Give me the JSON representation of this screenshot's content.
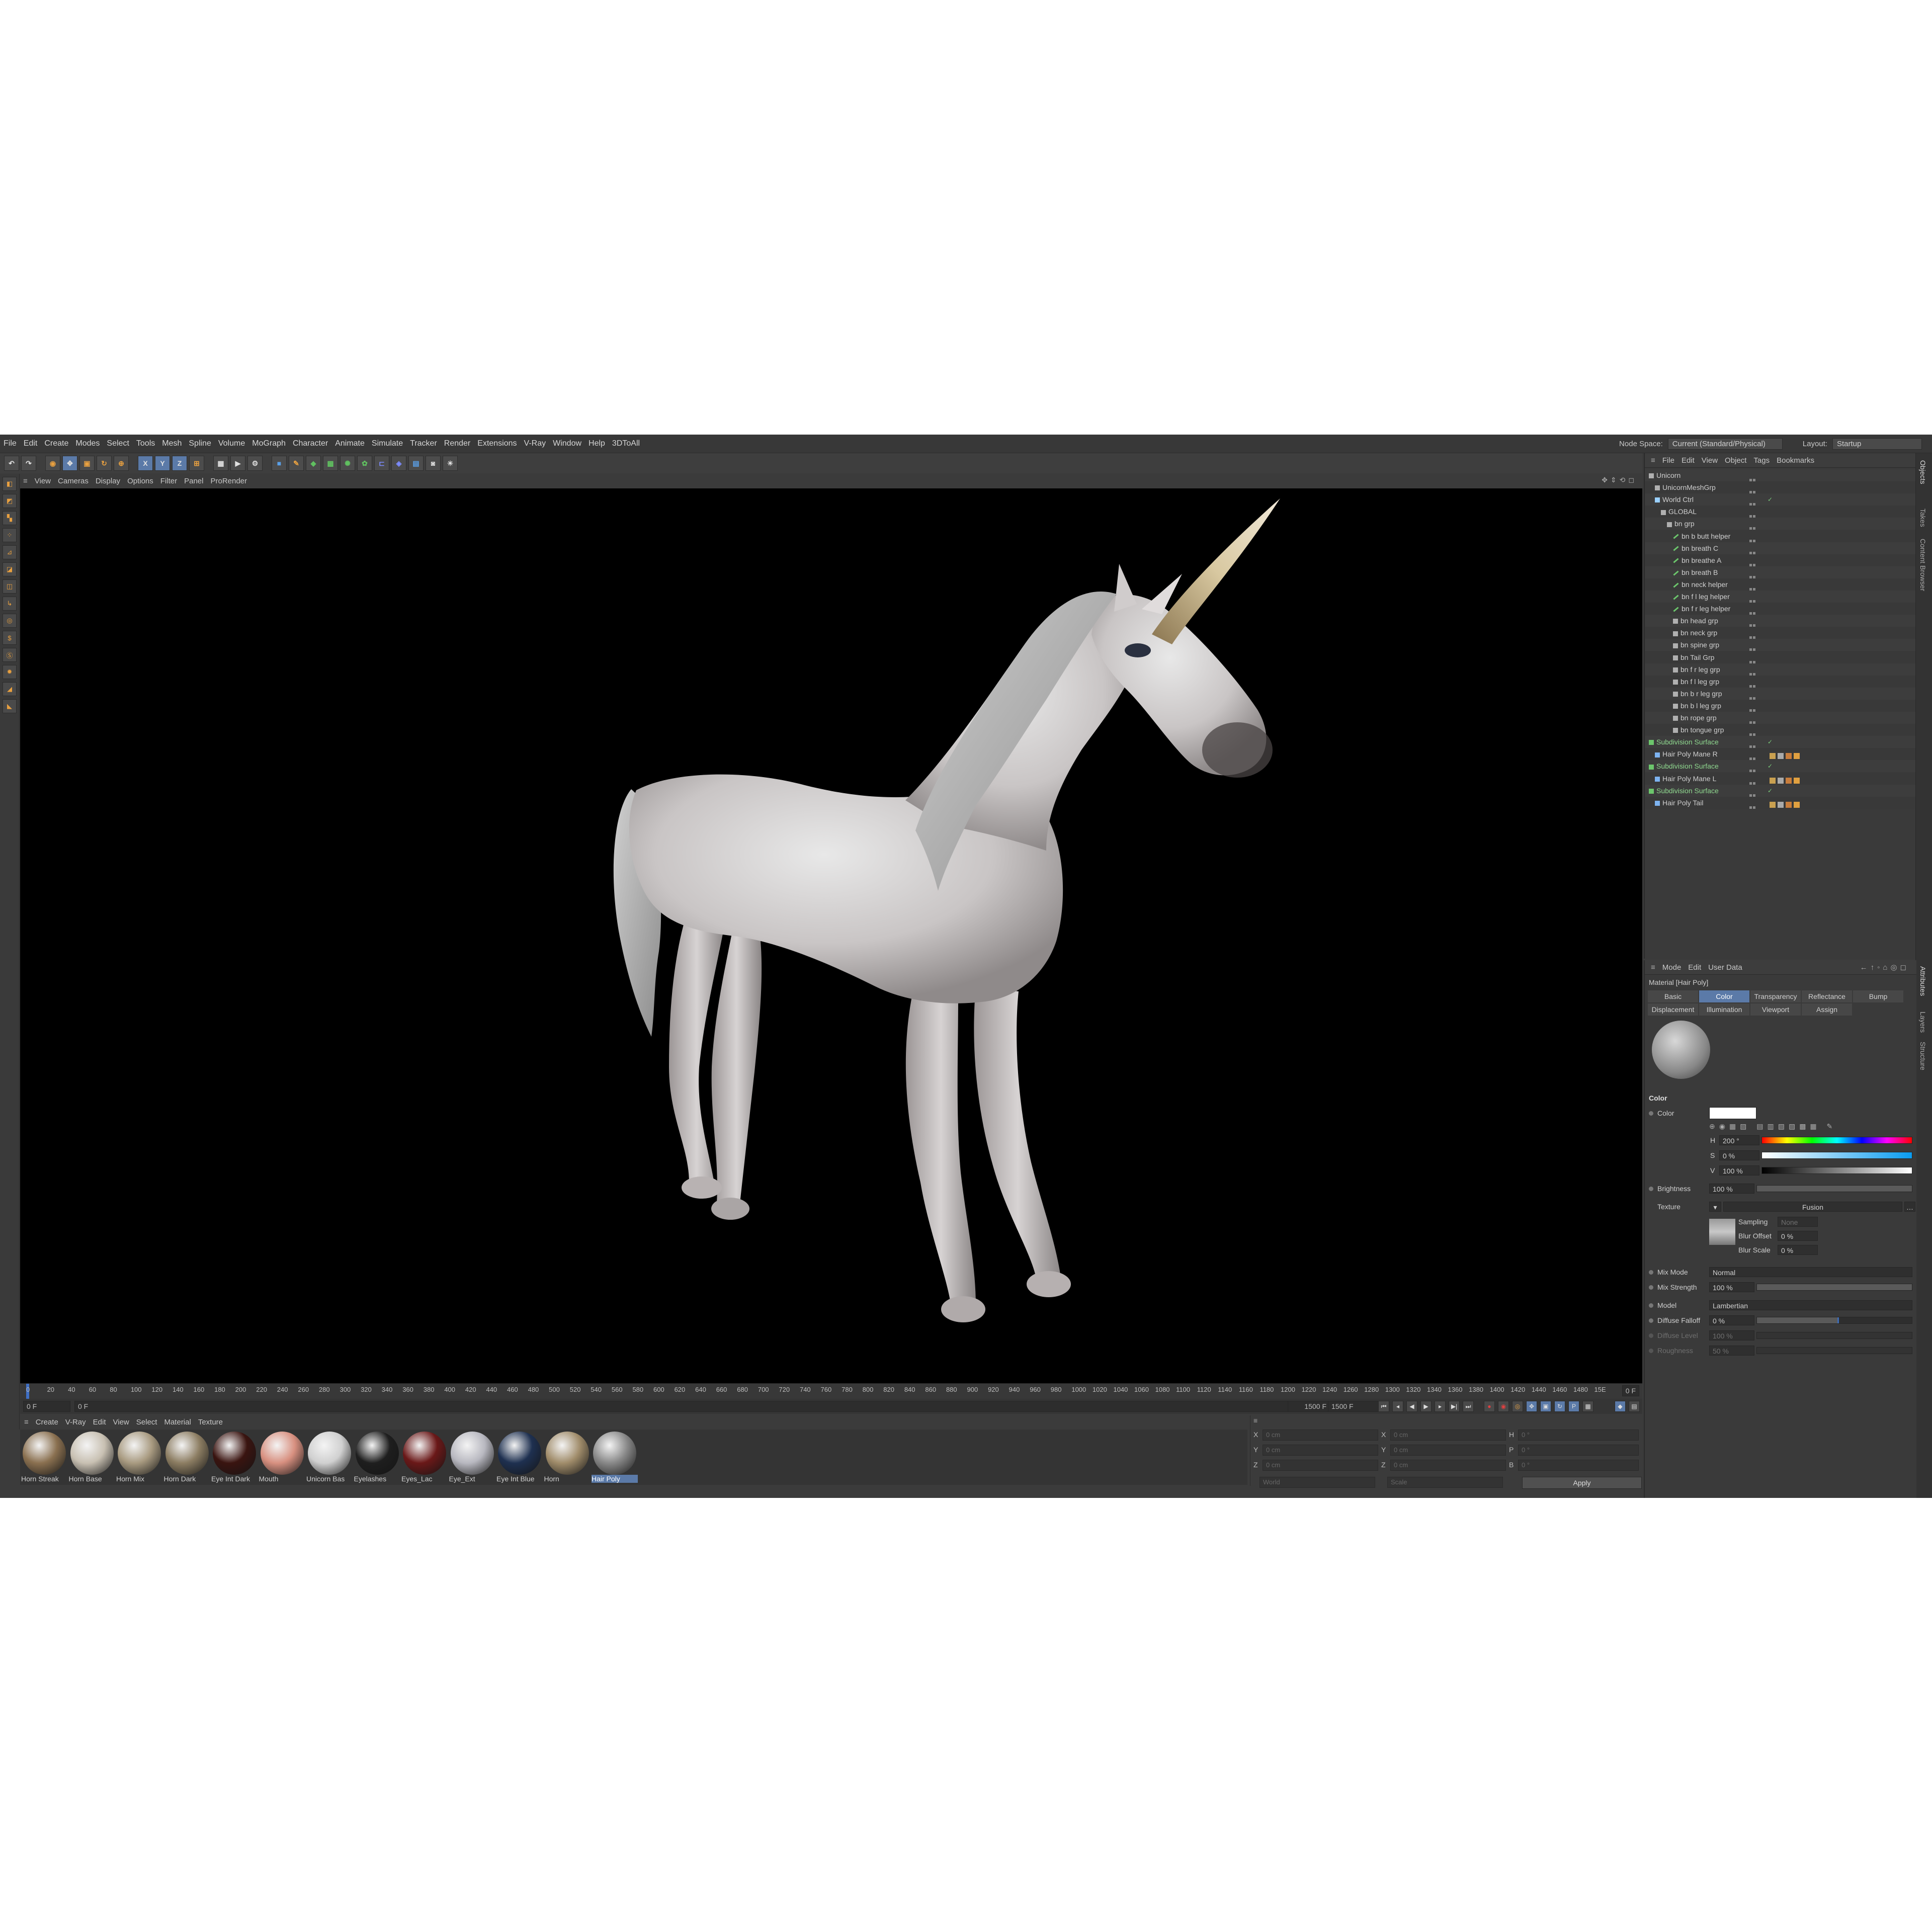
{
  "menubar": {
    "items": [
      "File",
      "Edit",
      "Create",
      "Modes",
      "Select",
      "Tools",
      "Mesh",
      "Spline",
      "Volume",
      "MoGraph",
      "Character",
      "Animate",
      "Simulate",
      "Tracker",
      "Render",
      "Extensions",
      "V-Ray",
      "Window",
      "Help",
      "3DToAll"
    ],
    "node_space_label": "Node Space:",
    "node_space_value": "Current (Standard/Physical)",
    "layout_label": "Layout:",
    "layout_value": "Startup"
  },
  "toolbar": {
    "axis_x": "X",
    "axis_y": "Y",
    "axis_z": "Z"
  },
  "viewport": {
    "menu": [
      "View",
      "Cameras",
      "Display",
      "Options",
      "Filter",
      "Panel",
      "ProRender"
    ],
    "subject": "unicorn"
  },
  "timeline": {
    "ticks": [
      "0",
      "20",
      "40",
      "60",
      "80",
      "100",
      "120",
      "140",
      "160",
      "180",
      "200",
      "220",
      "240",
      "260",
      "280",
      "300",
      "320",
      "340",
      "360",
      "380",
      "400",
      "420",
      "440",
      "460",
      "480",
      "500",
      "520",
      "540",
      "560",
      "580",
      "600",
      "620",
      "640",
      "660",
      "680",
      "700",
      "720",
      "740",
      "760",
      "780",
      "800",
      "820",
      "840",
      "860",
      "880",
      "900",
      "920",
      "940",
      "960",
      "980",
      "1000",
      "1020",
      "1040",
      "1060",
      "1080",
      "1100",
      "1120",
      "1140",
      "1160",
      "1180",
      "1200",
      "1220",
      "1240",
      "1260",
      "1280",
      "1300",
      "1320",
      "1340",
      "1360",
      "1380",
      "1400",
      "1420",
      "1440",
      "1460",
      "1480",
      "15E"
    ],
    "current_frame": "0 F",
    "start_frame": "0 F",
    "preview_start": "0 F",
    "preview_end": "1500 F",
    "end_frame": "1500 F",
    "current_readout": "0 F"
  },
  "material_manager": {
    "menu": [
      "Create",
      "V-Ray",
      "Edit",
      "View",
      "Select",
      "Material",
      "Texture"
    ],
    "materials": [
      {
        "name": "Horn Streak",
        "color": "#8a7050"
      },
      {
        "name": "Horn Base",
        "color": "#c8c0b2"
      },
      {
        "name": "Horn Mix",
        "color": "#a89a80"
      },
      {
        "name": "Horn Dark",
        "color": "#8c7d62"
      },
      {
        "name": "Eye Int Dark",
        "color": "#3a1410"
      },
      {
        "name": "Mouth",
        "color": "#d89080"
      },
      {
        "name": "Unicorn Bas",
        "color": "#d0d0d0"
      },
      {
        "name": "Eyelashes",
        "color": "#1e1e1e"
      },
      {
        "name": "Eyes_Lac",
        "color": "#6a1818"
      },
      {
        "name": "Eye_Ext",
        "color": "#b8b8c0"
      },
      {
        "name": "Eye Int Blue",
        "color": "#1e3050"
      },
      {
        "name": "Horn",
        "color": "#a08c6a"
      },
      {
        "name": "Hair Poly",
        "color": "#888888"
      }
    ],
    "selected": "Hair Poly"
  },
  "coordinates": {
    "rows": [
      {
        "a": "X",
        "av": "0 cm",
        "b": "X",
        "bv": "0 cm",
        "c": "H",
        "cv": "0 °"
      },
      {
        "a": "Y",
        "av": "0 cm",
        "b": "Y",
        "bv": "0 cm",
        "c": "P",
        "cv": "0 °"
      },
      {
        "a": "Z",
        "av": "0 cm",
        "b": "Z",
        "bv": "0 cm",
        "c": "B",
        "cv": "0 °"
      }
    ],
    "mode1": "World",
    "mode2": "Scale",
    "apply": "Apply"
  },
  "objects_panel": {
    "menu": [
      "File",
      "Edit",
      "View",
      "Object",
      "Tags",
      "Bookmarks"
    ],
    "items": [
      {
        "name": "Unicorn",
        "indent": 0,
        "type": "null"
      },
      {
        "name": "UnicornMeshGrp",
        "indent": 1,
        "type": "null"
      },
      {
        "name": "World Ctrl",
        "indent": 1,
        "type": "spline",
        "check": true
      },
      {
        "name": "GLOBAL",
        "indent": 2,
        "type": "null"
      },
      {
        "name": "bn grp",
        "indent": 3,
        "type": "null"
      },
      {
        "name": "bn b butt helper",
        "indent": 4,
        "type": "joint"
      },
      {
        "name": "bn breath C",
        "indent": 4,
        "type": "joint"
      },
      {
        "name": "bn breathe A",
        "indent": 4,
        "type": "joint"
      },
      {
        "name": "bn breath B",
        "indent": 4,
        "type": "joint"
      },
      {
        "name": "bn neck helper",
        "indent": 4,
        "type": "joint"
      },
      {
        "name": "bn f l leg helper",
        "indent": 4,
        "type": "joint"
      },
      {
        "name": "bn f r leg helper",
        "indent": 4,
        "type": "joint"
      },
      {
        "name": "bn head grp",
        "indent": 4,
        "type": "null"
      },
      {
        "name": "bn neck grp",
        "indent": 4,
        "type": "null"
      },
      {
        "name": "bn spine grp",
        "indent": 4,
        "type": "null"
      },
      {
        "name": "bn Tail Grp",
        "indent": 4,
        "type": "null"
      },
      {
        "name": "bn f r leg grp",
        "indent": 4,
        "type": "null"
      },
      {
        "name": "bn f l leg grp",
        "indent": 4,
        "type": "null"
      },
      {
        "name": "bn b r leg grp",
        "indent": 4,
        "type": "null"
      },
      {
        "name": "bn b l leg grp",
        "indent": 4,
        "type": "null"
      },
      {
        "name": "bn rope grp",
        "indent": 4,
        "type": "null"
      },
      {
        "name": "bn tongue grp",
        "indent": 4,
        "type": "null"
      },
      {
        "name": "Subdivision Surface",
        "indent": 0,
        "type": "subd",
        "check": true
      },
      {
        "name": "Hair Poly Mane R",
        "indent": 1,
        "type": "poly",
        "tags": true
      },
      {
        "name": "Subdivision Surface",
        "indent": 0,
        "type": "subd",
        "check": true
      },
      {
        "name": "Hair Poly Mane L",
        "indent": 1,
        "type": "poly",
        "tags": true
      },
      {
        "name": "Subdivision Surface",
        "indent": 0,
        "type": "subd",
        "check": true
      },
      {
        "name": "Hair Poly Tail",
        "indent": 1,
        "type": "poly",
        "tags": true
      }
    ]
  },
  "side_tabs": [
    "Objects",
    "Takes",
    "Content Browser",
    "Attributes",
    "Layers",
    "Structure"
  ],
  "attributes": {
    "menu": [
      "Mode",
      "Edit",
      "User Data"
    ],
    "title": "Material [Hair Poly]",
    "tabs_row1": [
      "Basic",
      "Color",
      "Transparency",
      "Reflectance",
      "Bump"
    ],
    "tabs_row2": [
      "Displacement",
      "Illumination",
      "Viewport",
      "Assign"
    ],
    "active_tab": "Color",
    "section": "Color",
    "color_label": "Color",
    "h_label": "H",
    "h_value": "200 °",
    "s_label": "S",
    "s_value": "0 %",
    "v_label": "V",
    "v_value": "100 %",
    "brightness_label": "Brightness",
    "brightness_value": "100 %",
    "texture_label": "Texture",
    "texture_value": "Fusion",
    "sampling_label": "Sampling",
    "sampling_value": "None",
    "blur_offset_label": "Blur Offset",
    "blur_offset_value": "0 %",
    "blur_scale_label": "Blur Scale",
    "blur_scale_value": "0 %",
    "mix_mode_label": "Mix Mode",
    "mix_mode_value": "Normal",
    "mix_strength_label": "Mix Strength",
    "mix_strength_value": "100 %",
    "model_label": "Model",
    "model_value": "Lambertian",
    "diffuse_falloff_label": "Diffuse Falloff",
    "diffuse_falloff_value": "0 %",
    "diffuse_level_label": "Diffuse Level",
    "diffuse_level_value": "100 %",
    "roughness_label": "Roughness",
    "roughness_value": "50 %"
  }
}
